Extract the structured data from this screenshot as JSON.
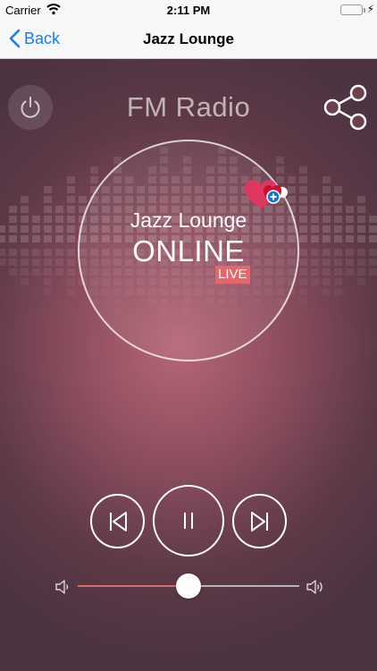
{
  "status_bar": {
    "carrier": "Carrier",
    "time": "2:11 PM",
    "battery_level": 1.0
  },
  "nav": {
    "back_label": "Back",
    "title": "Jazz Lounge"
  },
  "player": {
    "app_title": "FM Radio",
    "station_name": "Jazz Lounge",
    "status": "ONLINE",
    "live_badge": "LIVE",
    "is_playing": true,
    "volume": 0.5
  },
  "colors": {
    "accent_blue": "#1a7cf5",
    "live_badge": "#e8666a",
    "slider_fill": "#e0686d",
    "background_center": "#b66675",
    "background_edge": "#4b3341",
    "heart_pink": "#e0375f",
    "heart_red": "#c8102e",
    "plus_blue": "#1478d4"
  },
  "icons": {
    "back": "chevron-left-icon",
    "power": "power-icon",
    "share": "share-icon",
    "favorite": "heart-plus-icon",
    "previous": "skip-previous-icon",
    "pause": "pause-icon",
    "next": "skip-next-icon",
    "volume_low": "volume-low-icon",
    "volume_high": "volume-high-icon"
  }
}
